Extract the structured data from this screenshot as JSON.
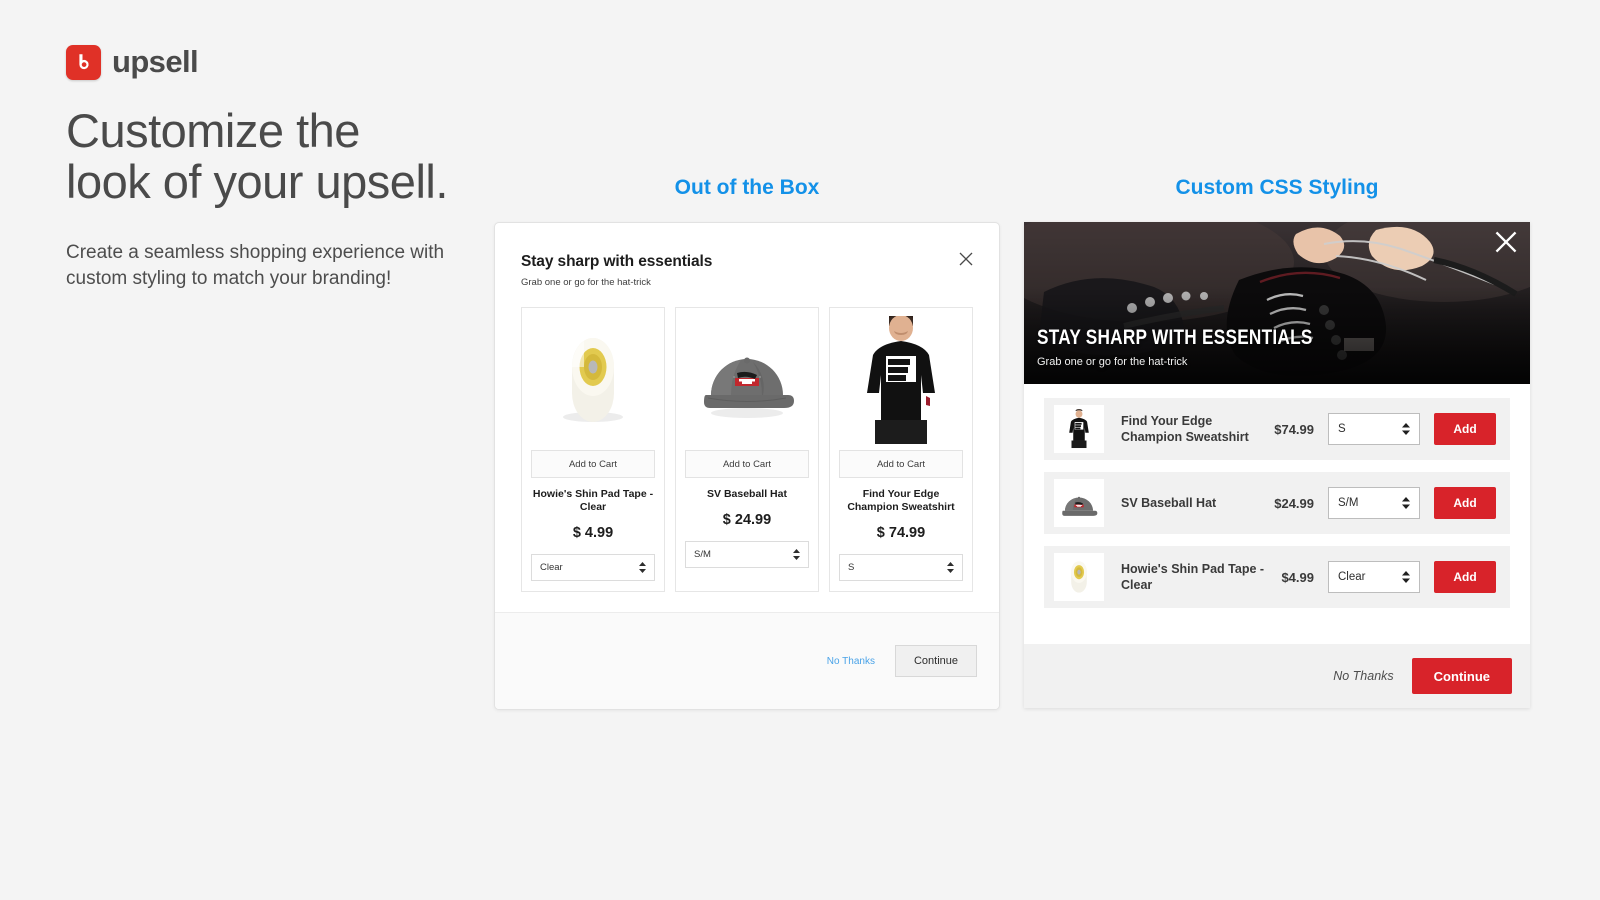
{
  "brand": {
    "logo_icon": "upsell-b-logo-icon",
    "name": "upsell",
    "logo_color": "#e03127"
  },
  "intro": {
    "headline_line1": "Customize the",
    "headline_line2": "look of your upsell.",
    "body": "Create a seamless shopping experience with custom styling to match your branding!"
  },
  "headings": {
    "out_of_the_box": "Out of the Box",
    "custom_css": "Custom CSS Styling",
    "accent_color": "#1391e8"
  },
  "ootb_modal": {
    "title": "Stay sharp with essentials",
    "subtitle": "Grab one or go for the hat-trick",
    "close_icon": "close-icon",
    "products": [
      {
        "image": "clear-tape-roll-image",
        "add_to_cart_label": "Add to Cart",
        "name": "Howie's Shin Pad Tape - Clear",
        "price": "$ 4.99",
        "variant": "Clear"
      },
      {
        "image": "gray-baseball-hat-image",
        "add_to_cart_label": "Add to Cart",
        "name": "SV Baseball Hat",
        "price": "$ 24.99",
        "variant": "S/M"
      },
      {
        "image": "black-sweatshirt-model-image",
        "add_to_cart_label": "Add to Cart",
        "name": "Find Your Edge Champion Sweatshirt",
        "price": "$ 74.99",
        "variant": "S"
      }
    ],
    "footer": {
      "no_thanks": "No Thanks",
      "continue": "Continue",
      "link_color": "#4aa3e8"
    }
  },
  "custom_modal": {
    "hero": {
      "image": "hockey-skate-lacing-photo",
      "title": "Stay sharp with essentials",
      "subtitle": "Grab one or go for the hat-trick",
      "close_icon": "close-icon"
    },
    "rows": [
      {
        "image": "black-sweatshirt-model-image",
        "name": "Find Your Edge Champion Sweatshirt",
        "price": "$74.99",
        "variant": "S",
        "add_label": "Add"
      },
      {
        "image": "gray-baseball-hat-image",
        "name": "SV Baseball Hat",
        "price": "$24.99",
        "variant": "S/M",
        "add_label": "Add"
      },
      {
        "image": "clear-tape-roll-image",
        "name": "Howie's Shin Pad Tape - Clear",
        "price": "$4.99",
        "variant": "Clear",
        "add_label": "Add"
      }
    ],
    "footer": {
      "no_thanks": "No Thanks",
      "continue": "Continue",
      "accent_color": "#d8232a"
    }
  }
}
